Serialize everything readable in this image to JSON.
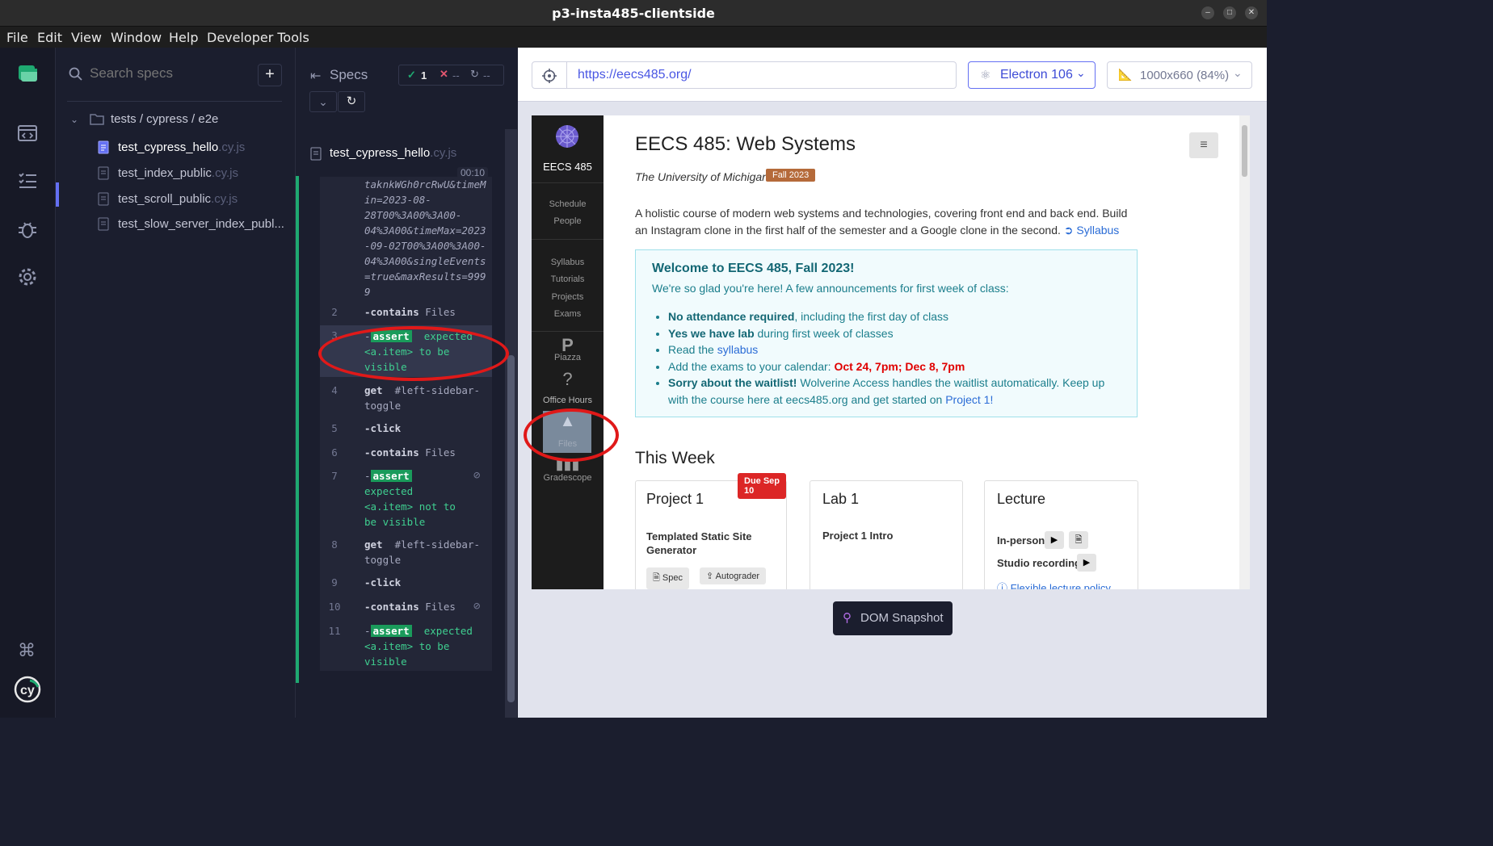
{
  "window": {
    "title": "p3-insta485-clientside"
  },
  "menu": [
    "File",
    "Edit",
    "View",
    "Window",
    "Help",
    "Developer Tools"
  ],
  "sidebar_icons": [
    "cypress-logo-icon",
    "runs-icon",
    "specs-icon",
    "debug-bug-icon",
    "settings-gear-icon",
    "command-icon",
    "cy-logo-icon"
  ],
  "specs": {
    "search_placeholder": "Search specs",
    "add_label": "+",
    "folder": "tests / cypress / e2e",
    "files": [
      {
        "name": "test_cypress_hello",
        "ext": ".cy.js"
      },
      {
        "name": "test_index_public",
        "ext": ".cy.js"
      },
      {
        "name": "test_scroll_public",
        "ext": ".cy.js"
      },
      {
        "name": "test_slow_server_index_publ...",
        "ext": ""
      }
    ]
  },
  "reporter": {
    "header_label": "Specs",
    "passed": "1",
    "failed": "--",
    "pending": "--",
    "spec_name": "test_cypress_hello",
    "spec_ext": ".cy.js",
    "duration": "00:10",
    "url_tail": "taknkWGh0rcRwU&timeMin=2023-08-28T00%3A00%3A00-04%3A00&timeMax=2023-09-02T00%3A00%3A00-04%3A00&singleEvents=true&maxResults=9999",
    "url_lines": [
      "taknkWGh0rcRwU&timeM",
      "in=2023-08-",
      "28T00%3A00%3A00-",
      "04%3A00&timeMax=2023",
      "-09-02T00%3A00%3A00-",
      "04%3A00&singleEvents",
      "=true&maxResults=999",
      "9"
    ],
    "commands": [
      {
        "num": "2",
        "name": "-contains",
        "arg": "Files"
      },
      {
        "num": "3",
        "name": "assert",
        "lines": [
          "expected",
          "<a.item> to be",
          "visible"
        ]
      },
      {
        "num": "4",
        "name": "get",
        "arg": "#left-sidebar-",
        "arg2": "toggle"
      },
      {
        "num": "5",
        "name": "-click",
        "arg": ""
      },
      {
        "num": "6",
        "name": "-contains",
        "arg": "Files"
      },
      {
        "num": "7",
        "name": "assert",
        "lines": [
          "expected",
          "<a.item> not to",
          "be visible"
        ]
      },
      {
        "num": "8",
        "name": "get",
        "arg": "#left-sidebar-",
        "arg2": "toggle"
      },
      {
        "num": "9",
        "name": "-click",
        "arg": ""
      },
      {
        "num": "10",
        "name": "-contains",
        "arg": "Files"
      },
      {
        "num": "11",
        "name": "assert",
        "lines": [
          "expected",
          "<a.item> to be",
          "visible"
        ]
      }
    ]
  },
  "preview": {
    "url": "https://eecs485.org/",
    "browser": "Electron 106",
    "viewport": "1000x660 (84%)",
    "dom_snapshot": "DOM Snapshot"
  },
  "site": {
    "brand": "EECS 485",
    "nav_group1": [
      "Schedule",
      "People"
    ],
    "nav_group2": [
      "Syllabus",
      "Tutorials",
      "Projects",
      "Exams"
    ],
    "piazza": "Piazza",
    "office_hours": "Office Hours",
    "files": "Files",
    "gradescope": "Gradescope",
    "title": "EECS 485: Web Systems",
    "subtitle": "The University of Michigan",
    "term_badge": "Fall 2023",
    "description_1": "A holistic course of modern web systems and technologies, covering front end and back end. Build",
    "description_2": "an Instagram clone in the first half of the semester and a Google clone in the second.",
    "syllabus_link": "Syllabus",
    "welcome_title": "Welcome to EECS 485, Fall 2023!",
    "welcome_sub": "We're so glad you're here! A few announcements for first week of class:",
    "bullet1_bold": "No attendance required",
    "bullet1_rest": ", including the first day of class",
    "bullet2_bold": "Yes we have lab",
    "bullet2_rest": " during first week of classes",
    "bullet3_pre": "Read the ",
    "bullet3_link": "syllabus",
    "bullet4_pre": "Add the exams to your calendar: ",
    "bullet4_red": "Oct 24, 7pm; Dec 8, 7pm",
    "bullet5_bold": "Sorry about the waitlist!",
    "bullet5_rest": " Wolverine Access handles the waitlist automatically. Keep up",
    "bullet5_line2": "with the course here at eecs485.org and get started on ",
    "bullet5_link": "Project 1!",
    "this_week": "This Week",
    "card1_title": "Project 1",
    "card1_badge": "Due Sep 10",
    "card1_sub_1": "Templated Static Site",
    "card1_sub_2": "Generator",
    "card1_btn1": "Spec",
    "card1_btn2": "Autograder",
    "card2_title": "Lab 1",
    "card2_sub": "Project 1 Intro",
    "card3_title": "Lecture",
    "card3_row1": "In-person",
    "card3_row2": "Studio recordings",
    "card3_link": "Flexible lecture policy"
  },
  "colors": {
    "accent": "#6470f3",
    "pass": "#1fa971",
    "annotation": "#e01919",
    "badge_fall": "#b56a3a",
    "due_badge": "#dc2626"
  }
}
